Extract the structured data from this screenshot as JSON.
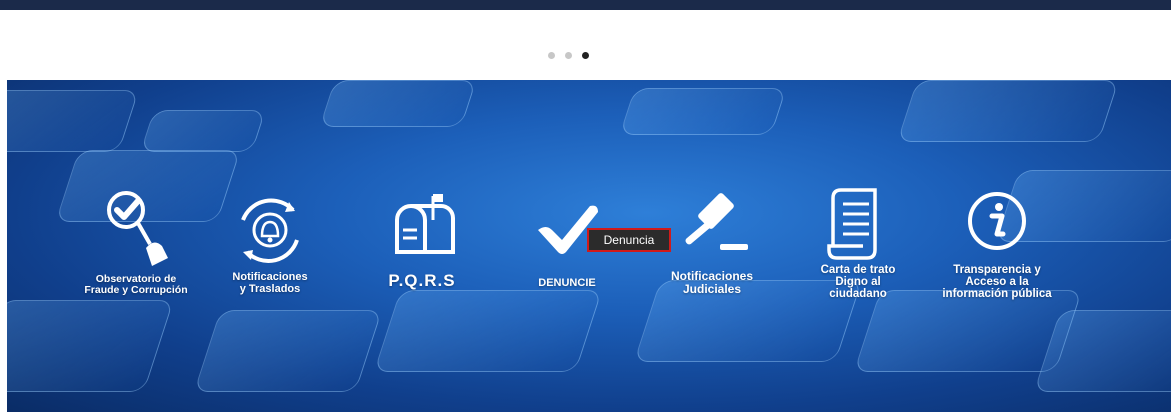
{
  "carousel": {
    "dots": 3,
    "active_index": 2
  },
  "items": [
    {
      "label": "Observatorio de\nFraude y Corrupción",
      "icon": "checkmark-magnifier-hand-icon"
    },
    {
      "label": "Notificaciones\ny Traslados",
      "icon": "bell-cycle-icon"
    },
    {
      "label": "P.Q.R.S",
      "icon": "mailbox-icon"
    },
    {
      "label": "DENUNCIE",
      "icon": "checkmark-icon"
    },
    {
      "label": "Notificaciones\nJudiciales",
      "icon": "gavel-icon"
    },
    {
      "label": "Carta de trato\nDigno al\nciudadano",
      "icon": "scroll-document-icon"
    },
    {
      "label": "Transparencia y\nAcceso  a la\ninformación pública",
      "icon": "info-icon"
    }
  ],
  "tooltip": {
    "text": "Denuncia"
  },
  "colors": {
    "topbar": "#1b2a4a",
    "banner_dark": "#0a2c66",
    "banner_light": "#2e7fd8",
    "tooltip_border": "#d11a1a"
  }
}
